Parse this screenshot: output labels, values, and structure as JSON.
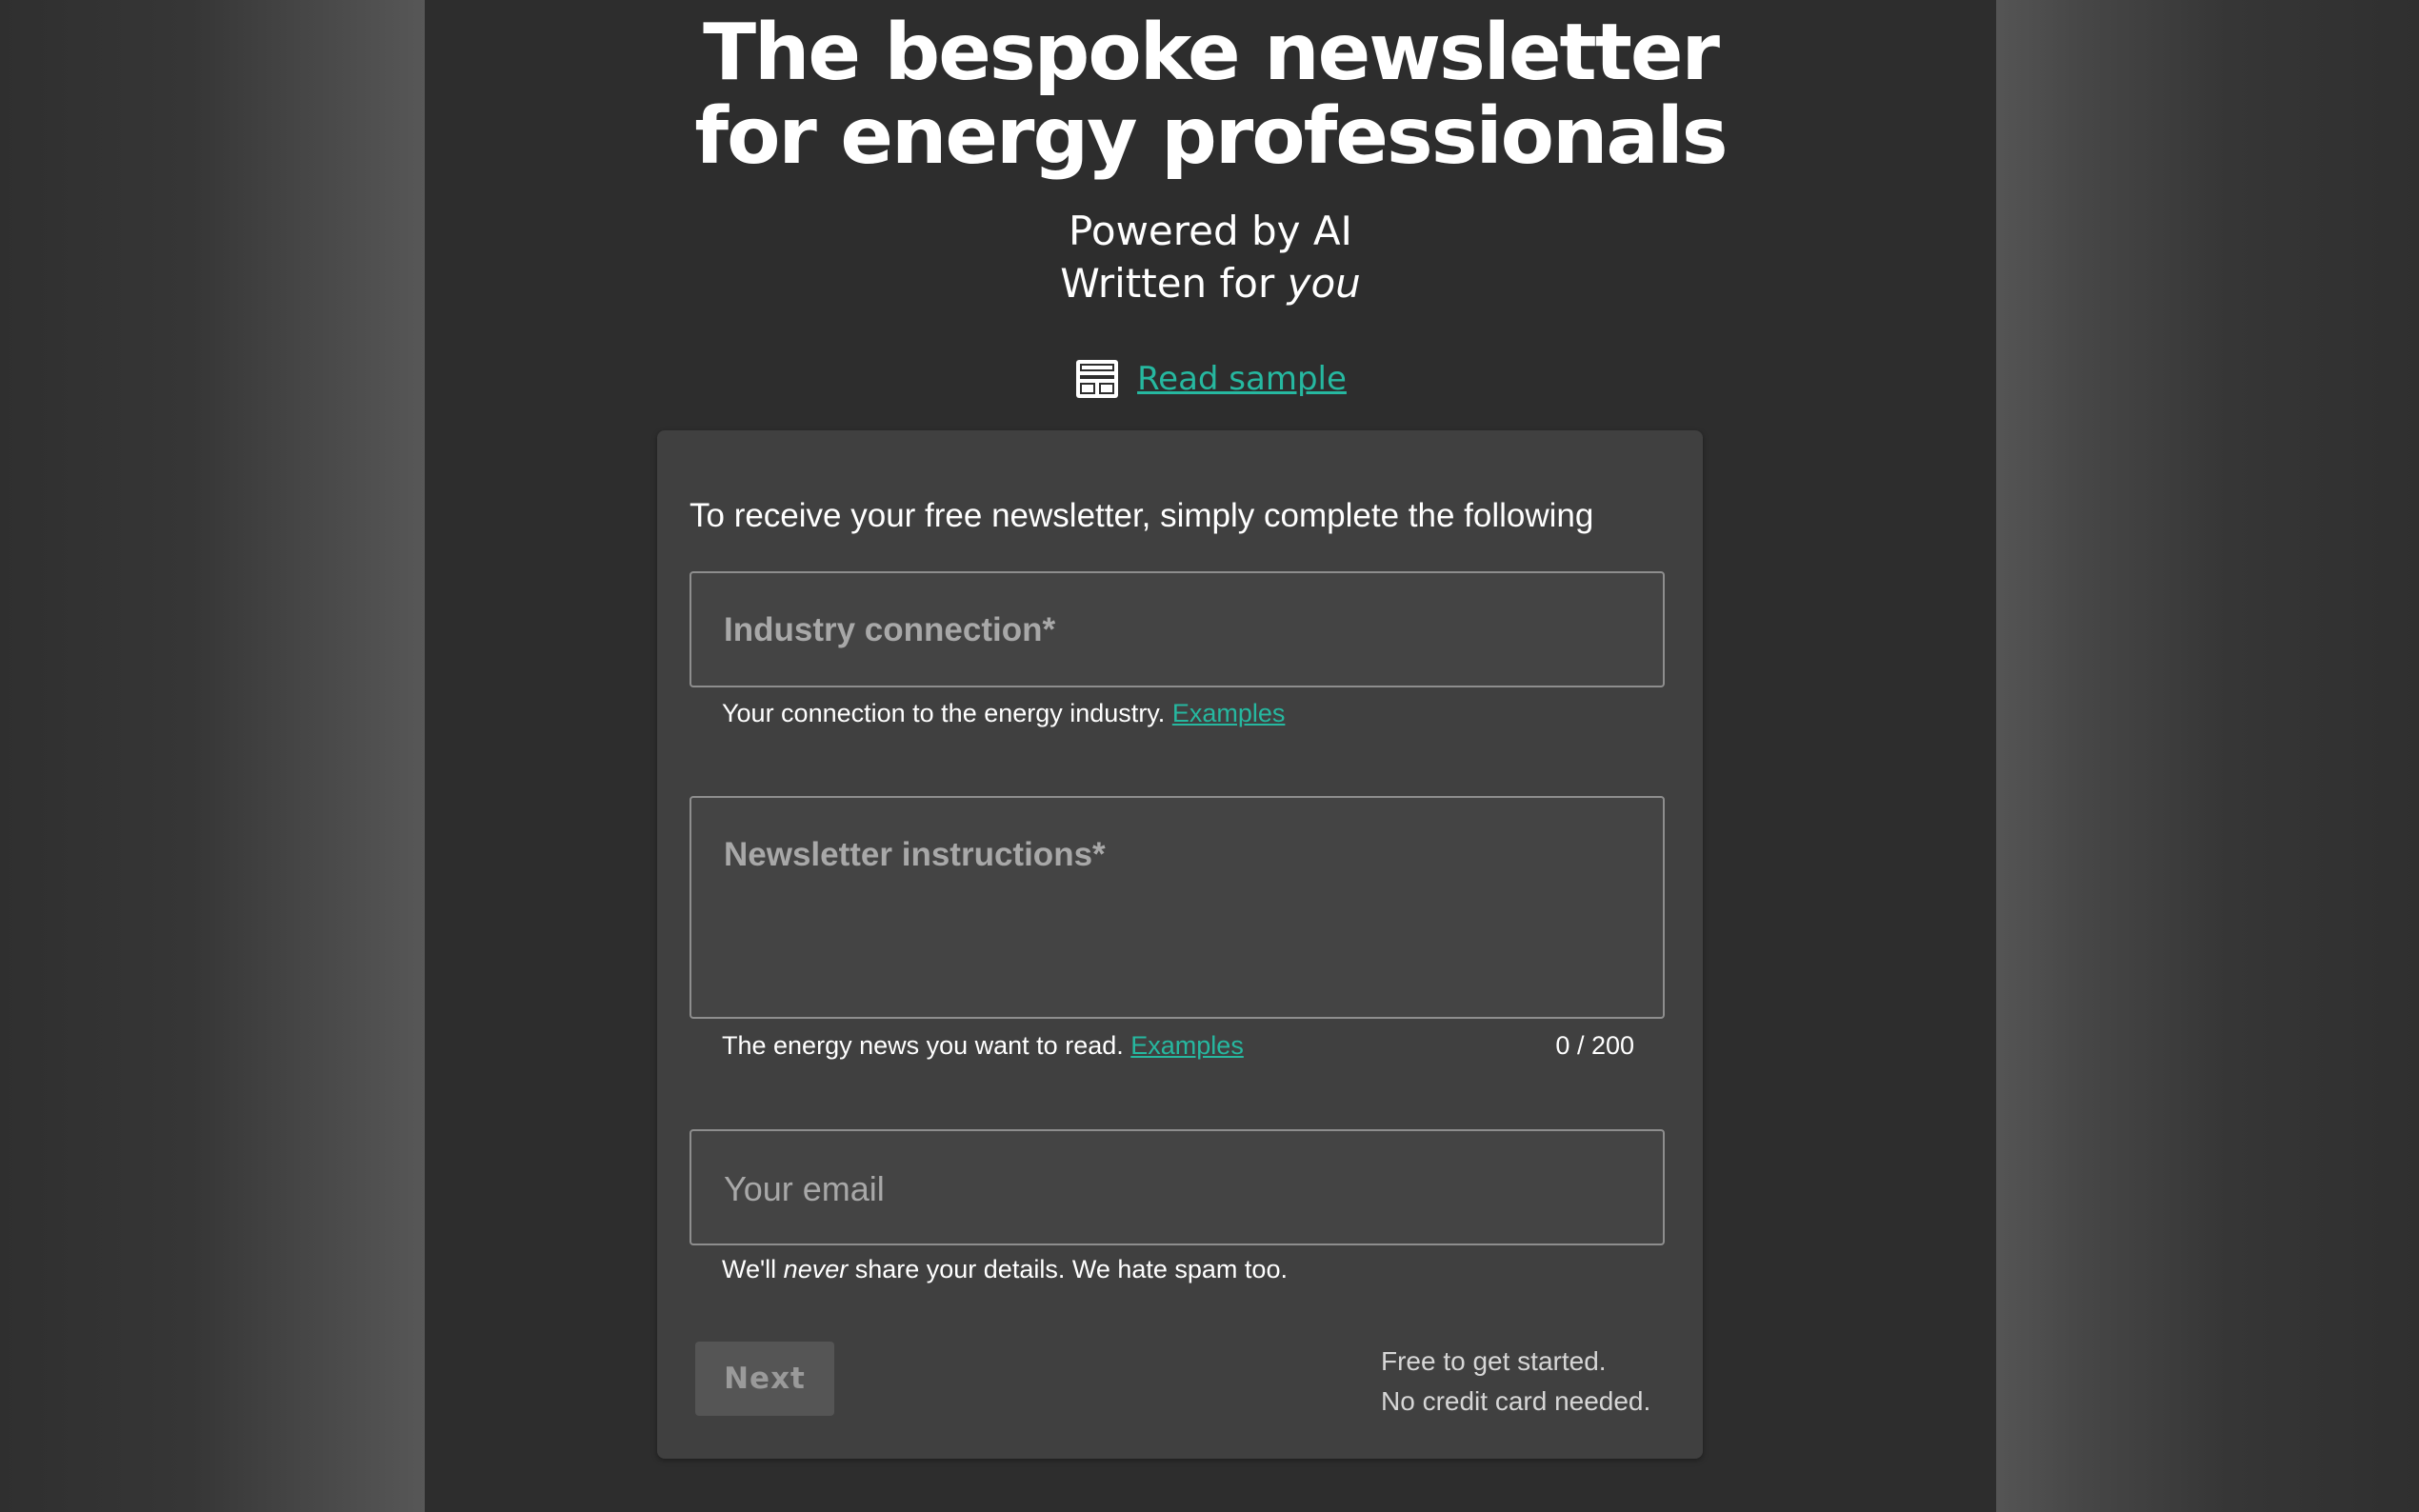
{
  "hero": {
    "title_line1": "The bespoke newsletter",
    "title_line2": "for energy professionals",
    "subtitle_line1": "Powered by AI",
    "subtitle_line2_prefix": "Written for ",
    "subtitle_line2_emph": "you"
  },
  "sample": {
    "icon": "newsletter-icon",
    "link_label": "Read sample"
  },
  "form": {
    "intro": "To receive your free newsletter, simply complete the following",
    "industry": {
      "label": "Industry connection*",
      "value": "",
      "helper": "Your connection to the energy industry.",
      "helper_link": "Examples"
    },
    "instructions": {
      "label": "Newsletter instructions*",
      "value": "",
      "helper": "The energy news you want to read.",
      "helper_link": "Examples",
      "counter": "0 / 200"
    },
    "email": {
      "label": "Your email",
      "value": "",
      "helper_prefix": "We'll ",
      "helper_emph": "never",
      "helper_suffix": " share your details. We hate spam too."
    },
    "next_label": "Next",
    "note_line1": "Free to get started.",
    "note_line2": "No credit card needed."
  },
  "colors": {
    "accent_link": "#26b8a0",
    "background": "#2d2d2d",
    "card": "#404040"
  }
}
